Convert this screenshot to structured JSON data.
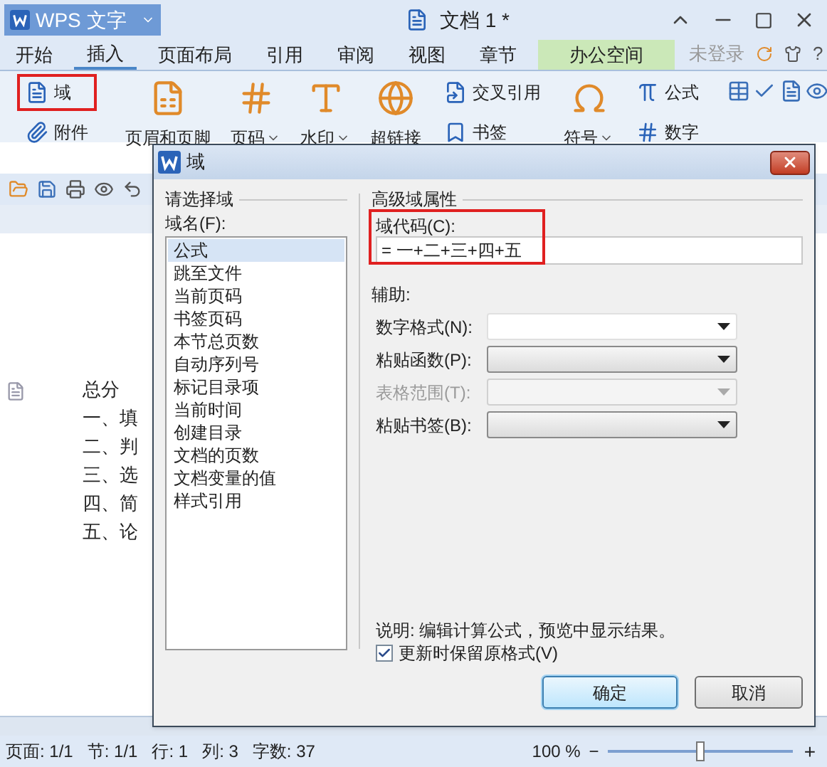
{
  "app_button": {
    "label": "WPS 文字"
  },
  "document_title": "文档 1 *",
  "menu_tabs": [
    {
      "label": "开始",
      "selected": false,
      "kind": "tab"
    },
    {
      "label": "插入",
      "selected": true,
      "kind": "tab"
    },
    {
      "label": "页面布局",
      "selected": false,
      "kind": "tab"
    },
    {
      "label": "引用",
      "selected": false,
      "kind": "tab"
    },
    {
      "label": "审阅",
      "selected": false,
      "kind": "tab"
    },
    {
      "label": "视图",
      "selected": false,
      "kind": "tab"
    },
    {
      "label": "章节",
      "selected": false,
      "kind": "tab"
    },
    {
      "label": "办公空间",
      "selected": false,
      "kind": "accent"
    }
  ],
  "login": "未登录",
  "help": "?",
  "ribbon": {
    "groups": [
      {
        "items": [
          {
            "label": "域",
            "kind": "small",
            "highlighted": true,
            "dropdown": false
          },
          {
            "label": "附件",
            "kind": "small",
            "highlighted": false,
            "dropdown": false
          }
        ]
      },
      {
        "items": [
          {
            "label": "页眉和页脚",
            "kind": "large",
            "highlighted": false,
            "dropdown": false
          }
        ]
      },
      {
        "items": [
          {
            "label": "页码",
            "kind": "large",
            "highlighted": false,
            "dropdown": true
          }
        ]
      },
      {
        "items": [
          {
            "label": "水印",
            "kind": "large",
            "highlighted": false,
            "dropdown": true
          }
        ]
      },
      {
        "items": [
          {
            "label": "超链接",
            "kind": "large",
            "highlighted": false,
            "dropdown": false
          }
        ]
      },
      {
        "items": [
          {
            "label": "交叉引用",
            "kind": "small",
            "highlighted": false,
            "dropdown": false
          },
          {
            "label": "书签",
            "kind": "small",
            "highlighted": false,
            "dropdown": false
          }
        ]
      },
      {
        "items": [
          {
            "label": "符号",
            "kind": "large",
            "highlighted": false,
            "dropdown": true
          }
        ]
      },
      {
        "items": [
          {
            "label": "公式",
            "kind": "small",
            "highlighted": false,
            "dropdown": false
          },
          {
            "label": "数字",
            "kind": "small",
            "highlighted": false,
            "dropdown": false
          }
        ]
      }
    ]
  },
  "document_lines": [
    "总分",
    "一、填",
    "二、判",
    "三、选",
    "四、简",
    "五、论"
  ],
  "dialog": {
    "title": "域",
    "left_group": {
      "legend": "请选择域",
      "list_label": "域名(F):",
      "items": [
        {
          "label": "公式",
          "selected": true
        },
        {
          "label": "跳至文件",
          "selected": false
        },
        {
          "label": "当前页码",
          "selected": false
        },
        {
          "label": "书签页码",
          "selected": false
        },
        {
          "label": "本节总页数",
          "selected": false
        },
        {
          "label": "自动序列号",
          "selected": false
        },
        {
          "label": "标记目录项",
          "selected": false
        },
        {
          "label": "当前时间",
          "selected": false
        },
        {
          "label": "创建目录",
          "selected": false
        },
        {
          "label": "文档的页数",
          "selected": false
        },
        {
          "label": "文档变量的值",
          "selected": false
        },
        {
          "label": "样式引用",
          "selected": false
        }
      ]
    },
    "right_group": {
      "legend": "高级域属性",
      "code_label": "域代码(C):",
      "code_value": "= 一+二+三+四+五",
      "code_highlighted": true,
      "helper_label": "辅助:",
      "fields": [
        {
          "label": "数字格式(N):",
          "kind": "combo",
          "disabled": false
        },
        {
          "label": "粘贴函数(P):",
          "kind": "dropdown",
          "disabled": false
        },
        {
          "label": "表格范围(T):",
          "kind": "dropdown",
          "disabled": true
        },
        {
          "label": "粘贴书签(B):",
          "kind": "dropdown",
          "disabled": false
        }
      ],
      "description": "说明: 编辑计算公式，预览中显示结果。",
      "keep_format": {
        "label": "更新时保留原格式(V)",
        "checked": true
      }
    },
    "buttons": [
      {
        "label": "确定",
        "default": true
      },
      {
        "label": "取消",
        "default": false
      }
    ]
  },
  "status_bar": {
    "items": [
      "页面: 1/1",
      "节: 1/1",
      "行: 1",
      "列: 3",
      "字数: 37"
    ],
    "zoom": "100 %",
    "zoom_out": "−",
    "zoom_in": "+",
    "zoom_slider": {
      "level": 0.5
    }
  }
}
